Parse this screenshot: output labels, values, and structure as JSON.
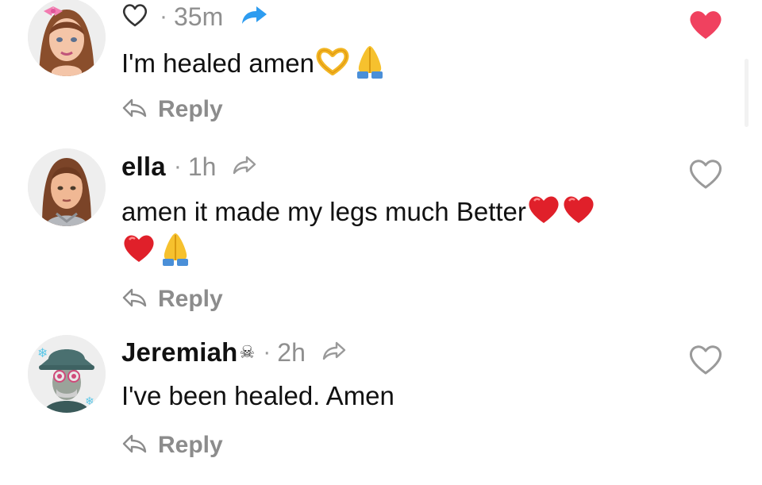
{
  "comments": [
    {
      "username": "",
      "time": "35m",
      "text": "I'm healed amen",
      "emojis": [
        "heart-hands",
        "folded-hands"
      ],
      "reply_label": "Reply",
      "liked": true,
      "avatar": "girl-avatar-bow"
    },
    {
      "username": "ella",
      "time": "1h",
      "text_line1": "amen it made my legs much Better",
      "emojis_line1": [
        "red-heart",
        "red-heart"
      ],
      "emojis_line2": [
        "red-heart",
        "folded-hands"
      ],
      "reply_label": "Reply",
      "liked": false,
      "avatar": "girl-avatar-hoodie"
    },
    {
      "username": "Jeremiah",
      "username_suffix": "☠",
      "time": "2h",
      "text": "I've been healed. Amen",
      "reply_label": "Reply",
      "liked": false,
      "avatar": "bucket-hat-avatar"
    }
  ],
  "colors": {
    "liked_heart": "#f0415f",
    "outline_icon": "#9a9a9a",
    "share_blue": "#2d9cf0",
    "muted_text": "#8c8c8c"
  }
}
